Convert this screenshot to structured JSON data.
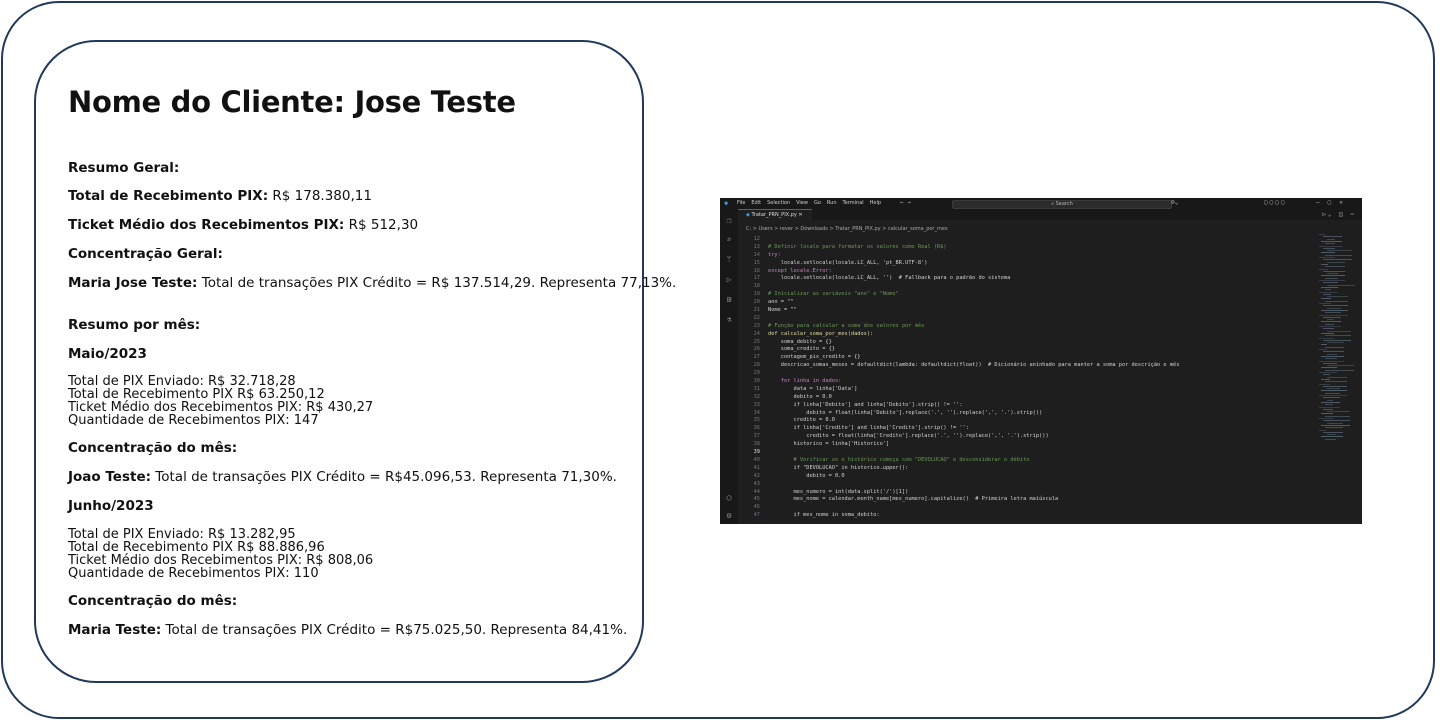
{
  "report": {
    "title": "Nome do Cliente: Jose Teste",
    "resumo_geral_heading": "Resumo Geral:",
    "total_recebimento_label": "Total de Recebimento PIX:",
    "total_recebimento_value": " R$ 178.380,11",
    "ticket_medio_label": "Ticket Médio dos Recebimentos PIX:",
    "ticket_medio_value": " R$ 512,30",
    "concentracao_geral_heading": "Concentração Geral:",
    "concentracao_geral_name": "Maria Jose Teste:",
    "concentracao_geral_text": " Total de transações PIX Crédito = R$ 137.514,29. Representa 77,13%.",
    "resumo_mes_heading": "Resumo por mês:",
    "months": [
      {
        "heading": "Maio/2023",
        "stats": [
          "Total de PIX Enviado:  R$ 32.718,28",
          "Total de Recebimento PIX R$ 63.250,12",
          "Ticket Médio dos Recebimentos PIX: R$ 430,27",
          "Quantidade de Recebimentos PIX: 147"
        ],
        "concentracao_heading": "Concentração do mês:",
        "concentracao_name": "Joao Teste:",
        "concentracao_text": " Total de transações PIX Crédito = R$45.096,53. Representa 71,30%."
      },
      {
        "heading": "Junho/2023",
        "stats": [
          "Total de PIX Enviado:  R$ 13.282,95",
          "Total de Recebimento PIX R$ 88.886,96",
          "Ticket Médio dos Recebimentos PIX: R$ 808,06",
          "Quantidade de Recebimentos PIX: 110"
        ],
        "concentracao_heading": "Concentração do mês:",
        "concentracao_name": "Maria Teste:",
        "concentracao_text": " Total de transações PIX Crédito = R$75.025,50. Representa 84,41%."
      }
    ]
  },
  "editor": {
    "menu": [
      "File",
      "Edit",
      "Selection",
      "View",
      "Go",
      "Run",
      "Terminal",
      "Help"
    ],
    "search_placeholder": "Search",
    "tab_label": "Tratar_PRN_PIX.py",
    "breadcrumb": "C: > Users > rever > Downloads > Tratar_PRN_PIX.py > calcular_soma_por_mes",
    "code_lines": [
      {
        "n": "12",
        "t": ""
      },
      {
        "n": "13",
        "t": "# Definir locale para formatar os valores como Real (R$)",
        "c": "#6a9955"
      },
      {
        "n": "14",
        "t": "try:",
        "c": "#c586c0"
      },
      {
        "n": "15",
        "t": "    locale.setlocale(locale.LC_ALL, 'pt_BR.UTF-8')"
      },
      {
        "n": "16",
        "t": "except locale.Error:",
        "c": "#c586c0"
      },
      {
        "n": "17",
        "t": "    locale.setlocale(locale.LC_ALL, '')  # Fallback para o padrão do sistema"
      },
      {
        "n": "18",
        "t": ""
      },
      {
        "n": "19",
        "t": "# Inicializar as variáveis \"ano\" e \"Nome\"",
        "c": "#6a9955"
      },
      {
        "n": "20",
        "t": "ano = \"\""
      },
      {
        "n": "21",
        "t": "Nome = \"\""
      },
      {
        "n": "22",
        "t": ""
      },
      {
        "n": "23",
        "t": "# Função para calcular a soma dos valores por mês",
        "c": "#6a9955"
      },
      {
        "n": "24",
        "t": "def calcular_soma_por_mes(dados):",
        "c": "#dcdcaa"
      },
      {
        "n": "25",
        "t": "    soma_debito = {}"
      },
      {
        "n": "26",
        "t": "    soma_credito = {}"
      },
      {
        "n": "27",
        "t": "    contagem_pix_credito = {}"
      },
      {
        "n": "28",
        "t": "    descricao_somas_meses = defaultdict(lambda: defaultdict(float))  # Dicionário aninhado para manter a soma por descrição e mês"
      },
      {
        "n": "29",
        "t": ""
      },
      {
        "n": "30",
        "t": "    for linha in dados:",
        "c": "#c586c0"
      },
      {
        "n": "31",
        "t": "        data = linha['Data']"
      },
      {
        "n": "32",
        "t": "        debito = 0.0"
      },
      {
        "n": "33",
        "t": "        if linha['Debito'] and linha['Debito'].strip() != '':"
      },
      {
        "n": "34",
        "t": "            debito = float(linha['Debito'].replace('.', '').replace(',', '.').strip())"
      },
      {
        "n": "35",
        "t": "        credito = 0.0"
      },
      {
        "n": "36",
        "t": "        if linha['Credito'] and linha['Credito'].strip() != '':"
      },
      {
        "n": "37",
        "t": "            credito = float(linha['Credito'].replace('.', '').replace(',', '.').strip())"
      },
      {
        "n": "38",
        "t": "        historico = linha['Historico']"
      },
      {
        "n": "39",
        "t": ""
      },
      {
        "n": "40",
        "t": "        # Verificar se o histórico começa com \"DEVOLUCAO\" e desconsiderar o débito",
        "c": "#6a9955"
      },
      {
        "n": "41",
        "t": "        if \"DEVOLUCAO\" in historico.upper():"
      },
      {
        "n": "42",
        "t": "            debito = 0.0"
      },
      {
        "n": "43",
        "t": ""
      },
      {
        "n": "44",
        "t": "        mes_numero = int(data.split('/')[1])"
      },
      {
        "n": "45",
        "t": "        mes_nome = calendar.month_name[mes_numero].capitalize()  # Primeira letra maiúscula"
      },
      {
        "n": "46",
        "t": ""
      },
      {
        "n": "47",
        "t": "        if mes_nome in soma_debito:"
      }
    ]
  }
}
